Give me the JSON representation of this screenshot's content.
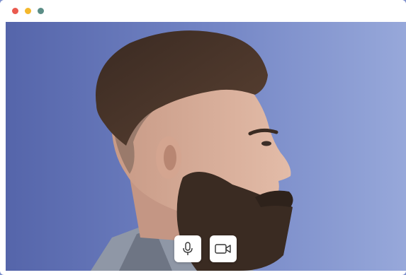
{
  "window": {
    "controls": [
      {
        "name": "close",
        "color": "#ea5a4f"
      },
      {
        "name": "minimize",
        "color": "#f4b82c"
      },
      {
        "name": "maximize",
        "color": "#5b8d86"
      }
    ]
  },
  "video": {
    "background_colors": [
      "#5a6aae",
      "#94a5d8"
    ],
    "subject": "man-profile-portrait"
  },
  "call_controls": [
    {
      "name": "microphone",
      "icon": "microphone-icon"
    },
    {
      "name": "camera",
      "icon": "video-camera-icon"
    }
  ]
}
